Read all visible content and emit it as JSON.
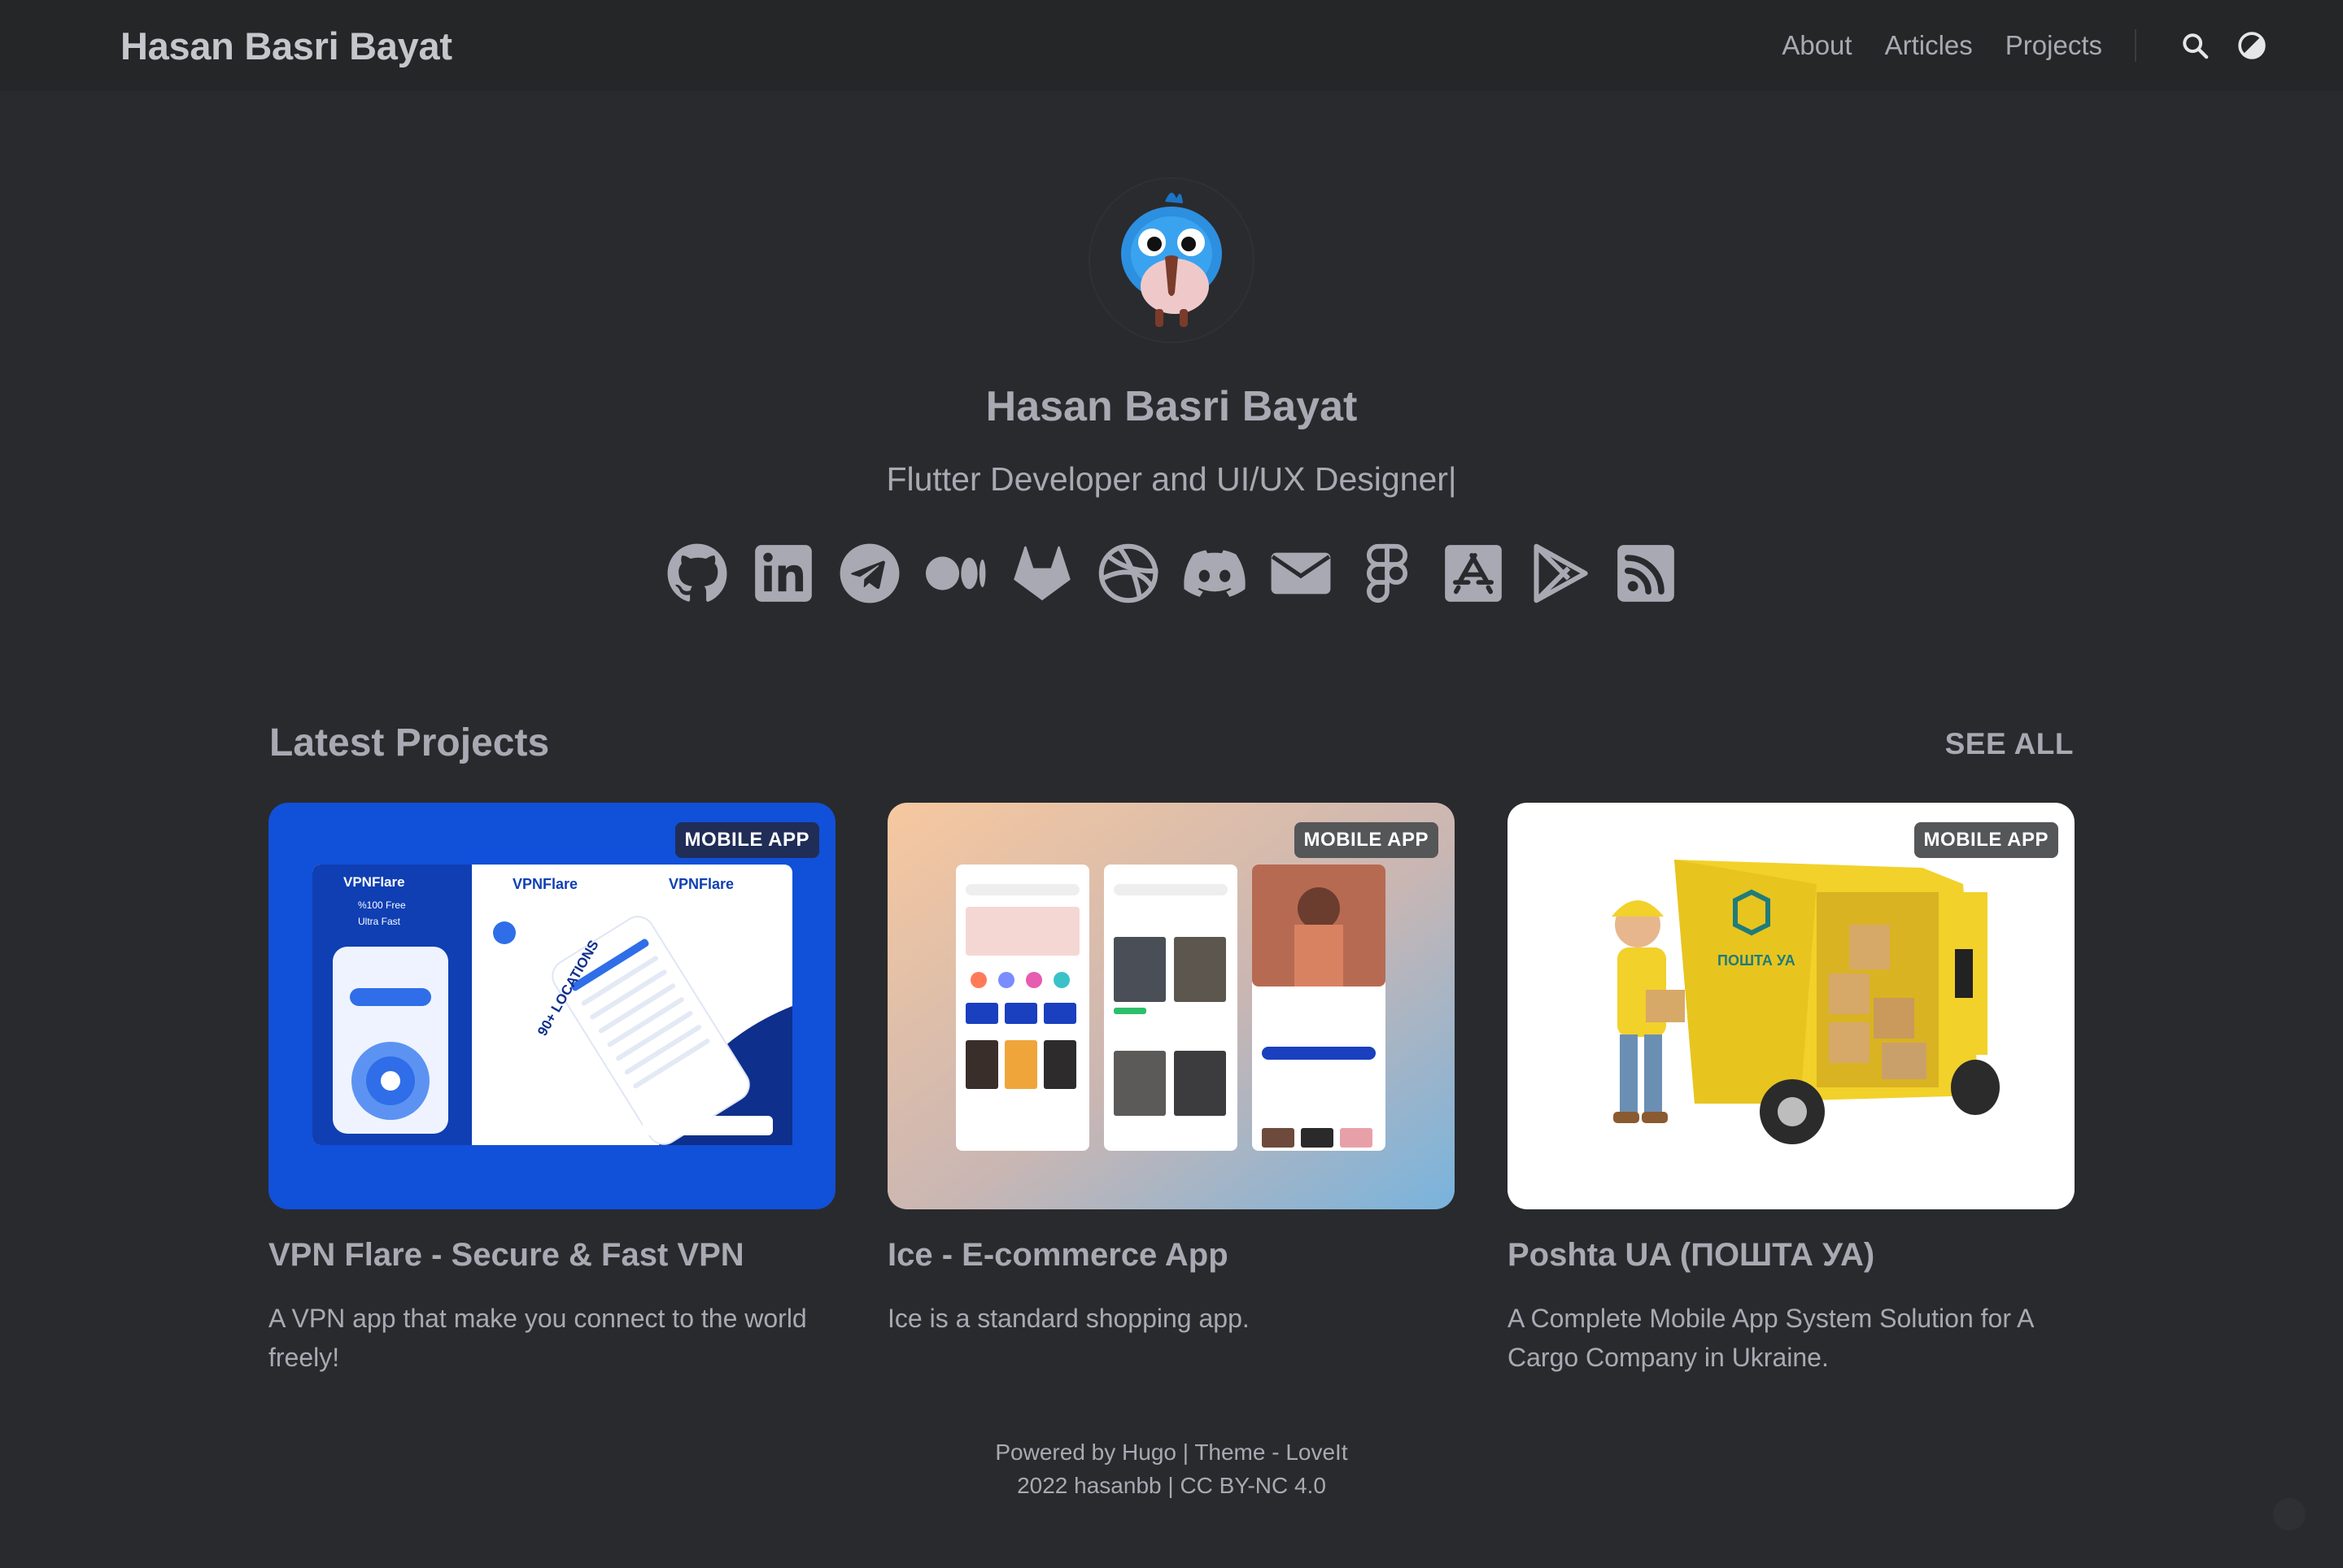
{
  "header": {
    "site_title": "Hasan Basri Bayat",
    "nav": [
      {
        "label": "About"
      },
      {
        "label": "Articles"
      },
      {
        "label": "Projects"
      }
    ],
    "icons": [
      "search-icon",
      "theme-toggle-icon"
    ]
  },
  "profile": {
    "name": "Hasan Basri Bayat",
    "subtitle": "Flutter Developer and UI/UX Designer|",
    "socials": [
      "github-icon",
      "linkedin-icon",
      "telegram-icon",
      "medium-icon",
      "gitlab-icon",
      "dribbble-icon",
      "discord-icon",
      "email-icon",
      "figma-icon",
      "app-store-icon",
      "google-play-icon",
      "rss-icon"
    ]
  },
  "projects": {
    "title": "Latest Projects",
    "see_all": "SEE ALL",
    "items": [
      {
        "badge": "MOBILE APP",
        "title": "VPN Flare - Secure & Fast VPN",
        "description": "A VPN app that make you connect to the world freely!",
        "image_text": {
          "brand": "VPNFlare",
          "line1": "%100 Free",
          "line2": "Ultra Fast",
          "locations": "90+ LOCATIONS"
        }
      },
      {
        "badge": "MOBILE APP",
        "title": "Ice - E-commerce App",
        "description": "Ice is a standard shopping app."
      },
      {
        "badge": "MOBILE APP",
        "title": "Poshta UA (ПОШТА УА)",
        "description": "A Complete Mobile App System Solution for A Cargo Company in Ukraine.",
        "image_text": {
          "logo": "ПОШТА УА"
        }
      }
    ]
  },
  "footer": {
    "line1_prefix": "Powered by",
    "hugo": "Hugo",
    "separator": "|",
    "theme": "Theme - LoveIt",
    "year": "2022",
    "author": "hasanbb",
    "license": "CC BY-NC 4.0"
  },
  "colors": {
    "background": "#292a2d",
    "header": "#252627",
    "text": "#a9a9b3",
    "badge_blue": "#1f2d57",
    "badge_grey": "#555658",
    "vpn_blue": "#1150d8",
    "poshta_yellow": "#f2d12a"
  }
}
